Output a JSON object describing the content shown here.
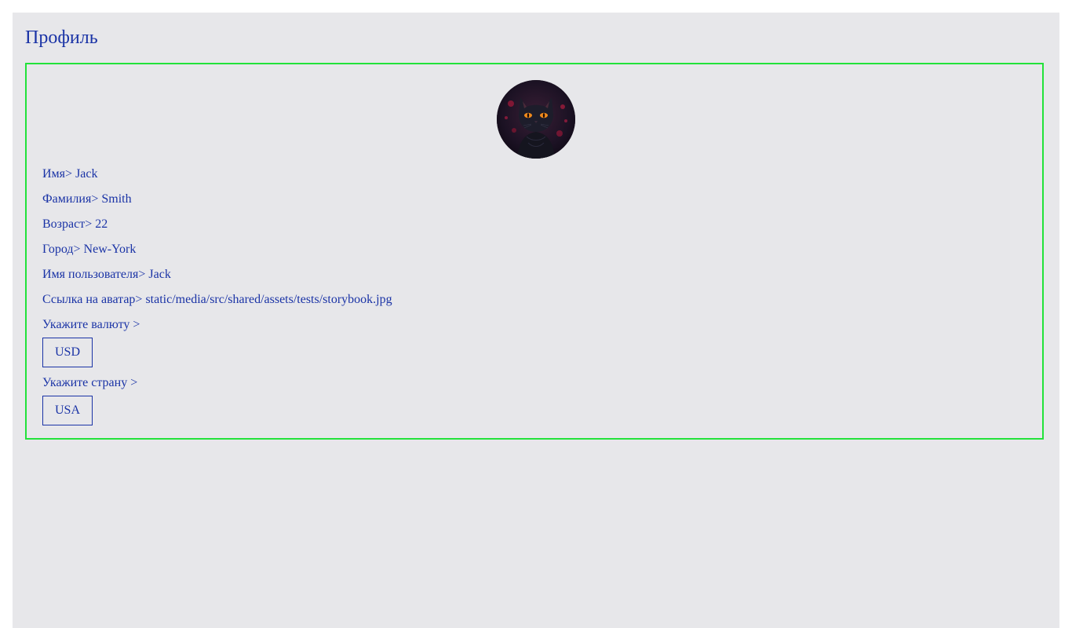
{
  "page": {
    "title": "Профиль"
  },
  "profile": {
    "avatar_icon": "black-cat-avatar",
    "fields": [
      {
        "label": "Имя>",
        "value": "Jack"
      },
      {
        "label": "Фамилия>",
        "value": "Smith"
      },
      {
        "label": "Возраст>",
        "value": "22"
      },
      {
        "label": "Город>",
        "value": "New-York"
      },
      {
        "label": "Имя пользователя>",
        "value": "Jack"
      },
      {
        "label": "Ссылка на аватар>",
        "value": "static/media/src/shared/assets/tests/storybook.jpg"
      }
    ],
    "currency_label": "Укажите валюту >",
    "currency_value": "USD",
    "country_label": "Укажите страну >",
    "country_value": "USA"
  },
  "colors": {
    "text": "#1a33a6",
    "card_border": "#22e23a",
    "background": "#e7e7ea",
    "glitch": "#ff00ff"
  }
}
